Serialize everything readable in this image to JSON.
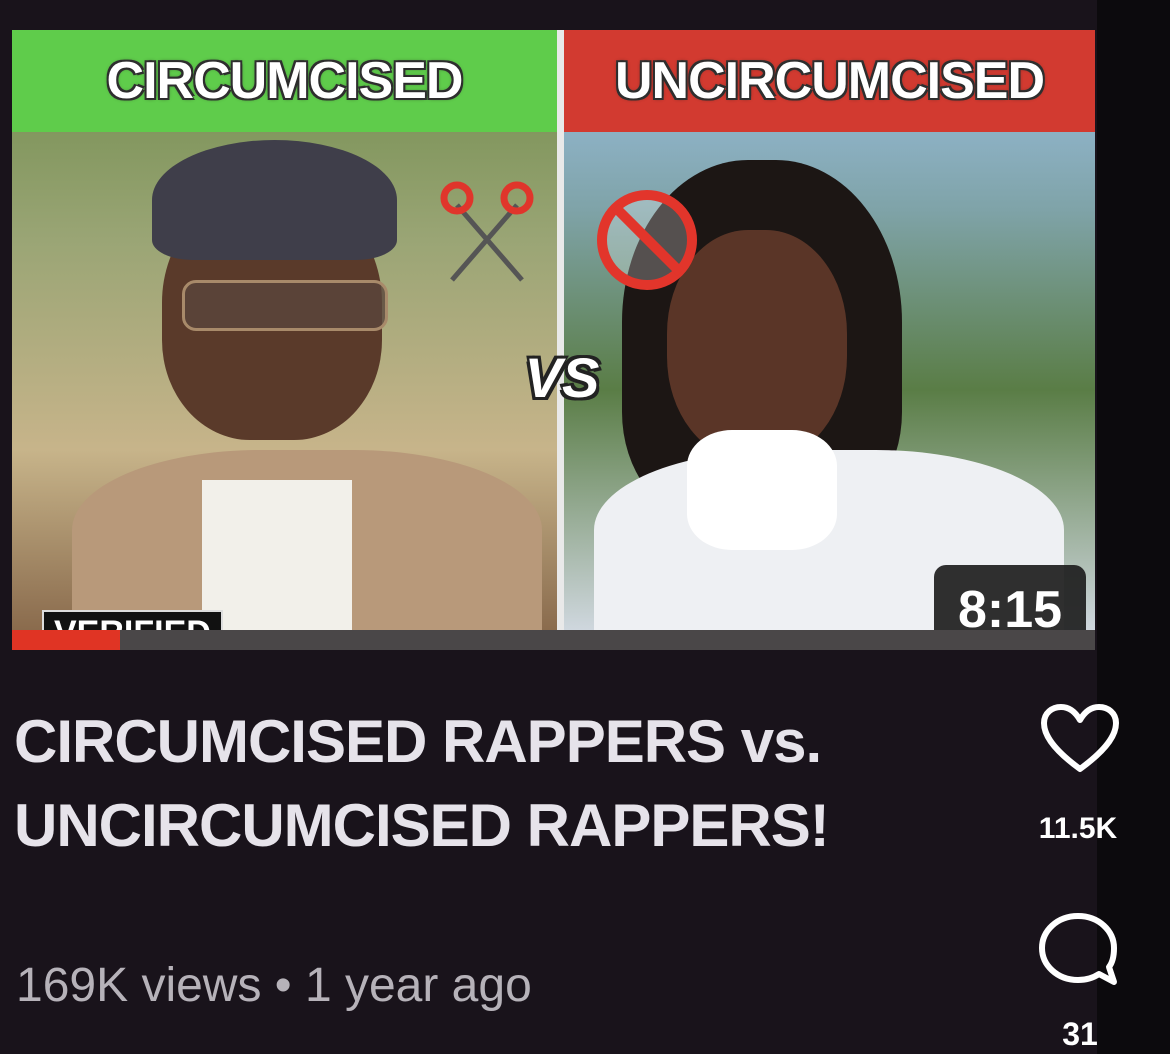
{
  "thumbnail": {
    "left_label": "CIRCUMCISED",
    "right_label": "UNCIRCUMCISED",
    "vs_text": "VS",
    "verified_badge": "VERIFIED",
    "duration": "8:15",
    "progress_fraction": 0.1,
    "left_color": "#5fcc4b",
    "right_color": "#d23a30",
    "left_icon": "scissors-icon",
    "right_icon": "prohibited-icon"
  },
  "video": {
    "title_line1": "CIRCUMCISED RAPPERS vs.",
    "title_line2": "UNCIRCUMCISED RAPPERS!",
    "meta": "169K views • 1 year ago"
  },
  "actions": {
    "like_count": "11.5K",
    "comment_count": "31",
    "like_icon": "heart-icon",
    "comment_icon": "comment-bubble-icon"
  }
}
